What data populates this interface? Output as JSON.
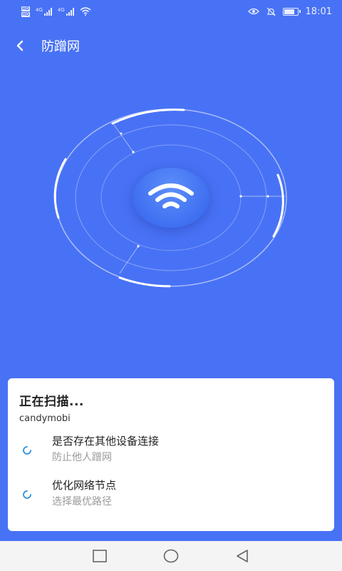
{
  "status_bar": {
    "hd1": "HD",
    "hd2": "HD",
    "net1": "4G",
    "net2": "4G",
    "time": "18:01",
    "battery_level": 0.7
  },
  "header": {
    "title": "防蹭网",
    "back_icon": "chevron-left-icon"
  },
  "radar": {
    "center_icon": "wifi-icon",
    "state": "scanning"
  },
  "scan_card": {
    "title": "正在扫描...",
    "network_name": "candymobi",
    "tasks": [
      {
        "title": "是否存在其他设备连接",
        "desc": "防止他人蹭网",
        "icon": "loading-spinner-icon"
      },
      {
        "title": "优化网络节点",
        "desc": "选择最优路径",
        "icon": "loading-spinner-icon"
      }
    ]
  },
  "nav_bar": {
    "recent_icon": "square-icon",
    "home_icon": "circle-icon",
    "back_icon": "triangle-back-icon"
  },
  "colors": {
    "background": "#4872f5",
    "card": "#ffffff",
    "spinner": "#2f8fe0",
    "nav_bar": "#f4f4f4"
  }
}
